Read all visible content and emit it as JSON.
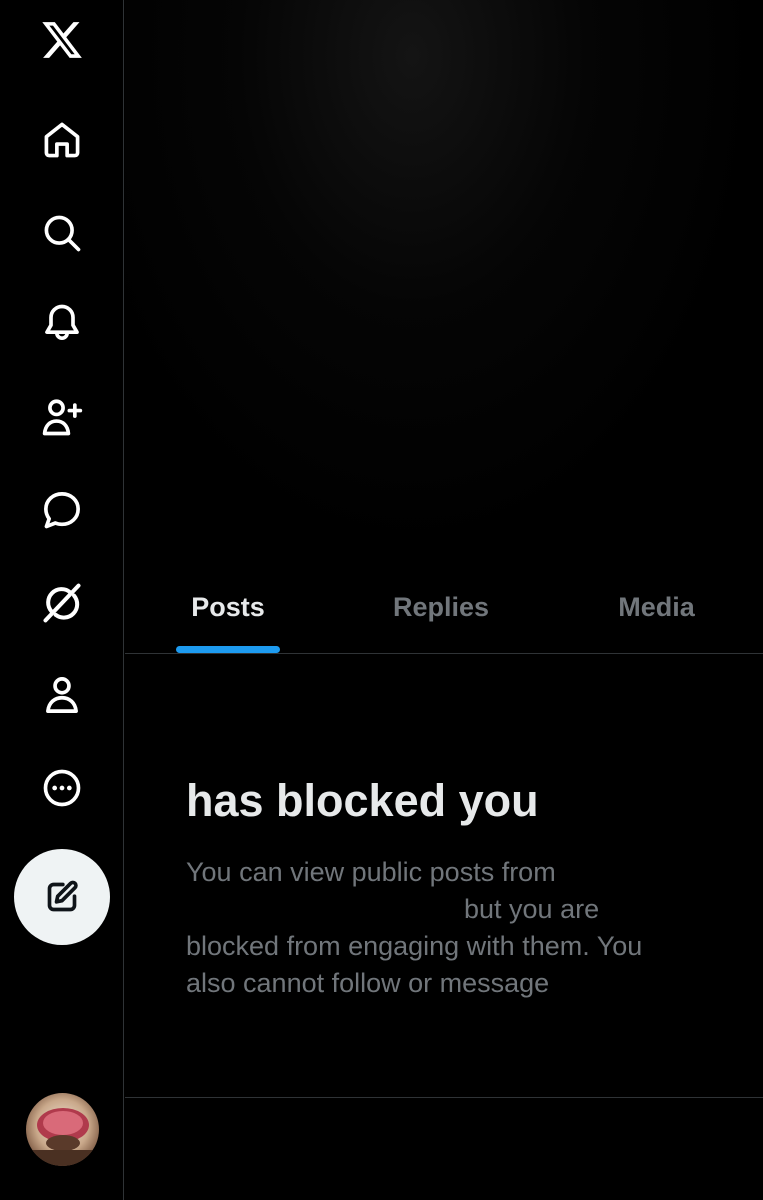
{
  "sidebar": {
    "items": [
      {
        "name": "x-logo-icon"
      },
      {
        "name": "home-icon"
      },
      {
        "name": "search-icon"
      },
      {
        "name": "bell-icon"
      },
      {
        "name": "person-add-icon"
      },
      {
        "name": "message-icon"
      },
      {
        "name": "grok-icon"
      },
      {
        "name": "profile-icon"
      },
      {
        "name": "more-icon"
      }
    ],
    "compose_icon": "compose-icon"
  },
  "tabs": [
    {
      "label": "Posts",
      "active": true
    },
    {
      "label": "Replies",
      "active": false
    },
    {
      "label": "Media",
      "active": false
    }
  ],
  "blocked": {
    "title": "has blocked you",
    "line1": "You can view public posts from",
    "line2": "but you are",
    "line3": "blocked from engaging with them. You",
    "line4": "also cannot follow or message"
  },
  "colors": {
    "accent": "#1d9bf0",
    "background": "#000000",
    "text_primary": "#e7e9ea",
    "text_secondary": "#71767b"
  }
}
